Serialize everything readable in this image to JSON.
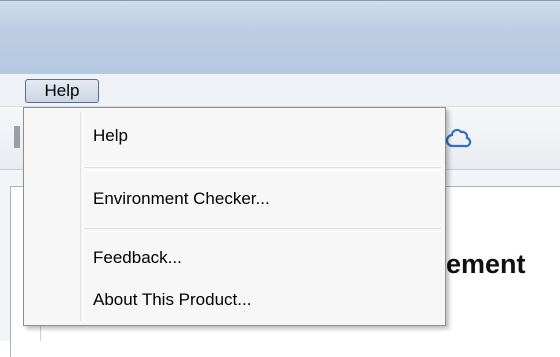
{
  "menubar": {
    "help_label": "Help"
  },
  "help_menu": {
    "items": [
      {
        "label": "Help"
      },
      {
        "label": "Environment Checker..."
      },
      {
        "label": "Feedback..."
      },
      {
        "label": "About This Product..."
      }
    ]
  },
  "content": {
    "heading_fragment": "ement"
  },
  "toolbar": {
    "icons": [
      "cloud-icon"
    ]
  }
}
